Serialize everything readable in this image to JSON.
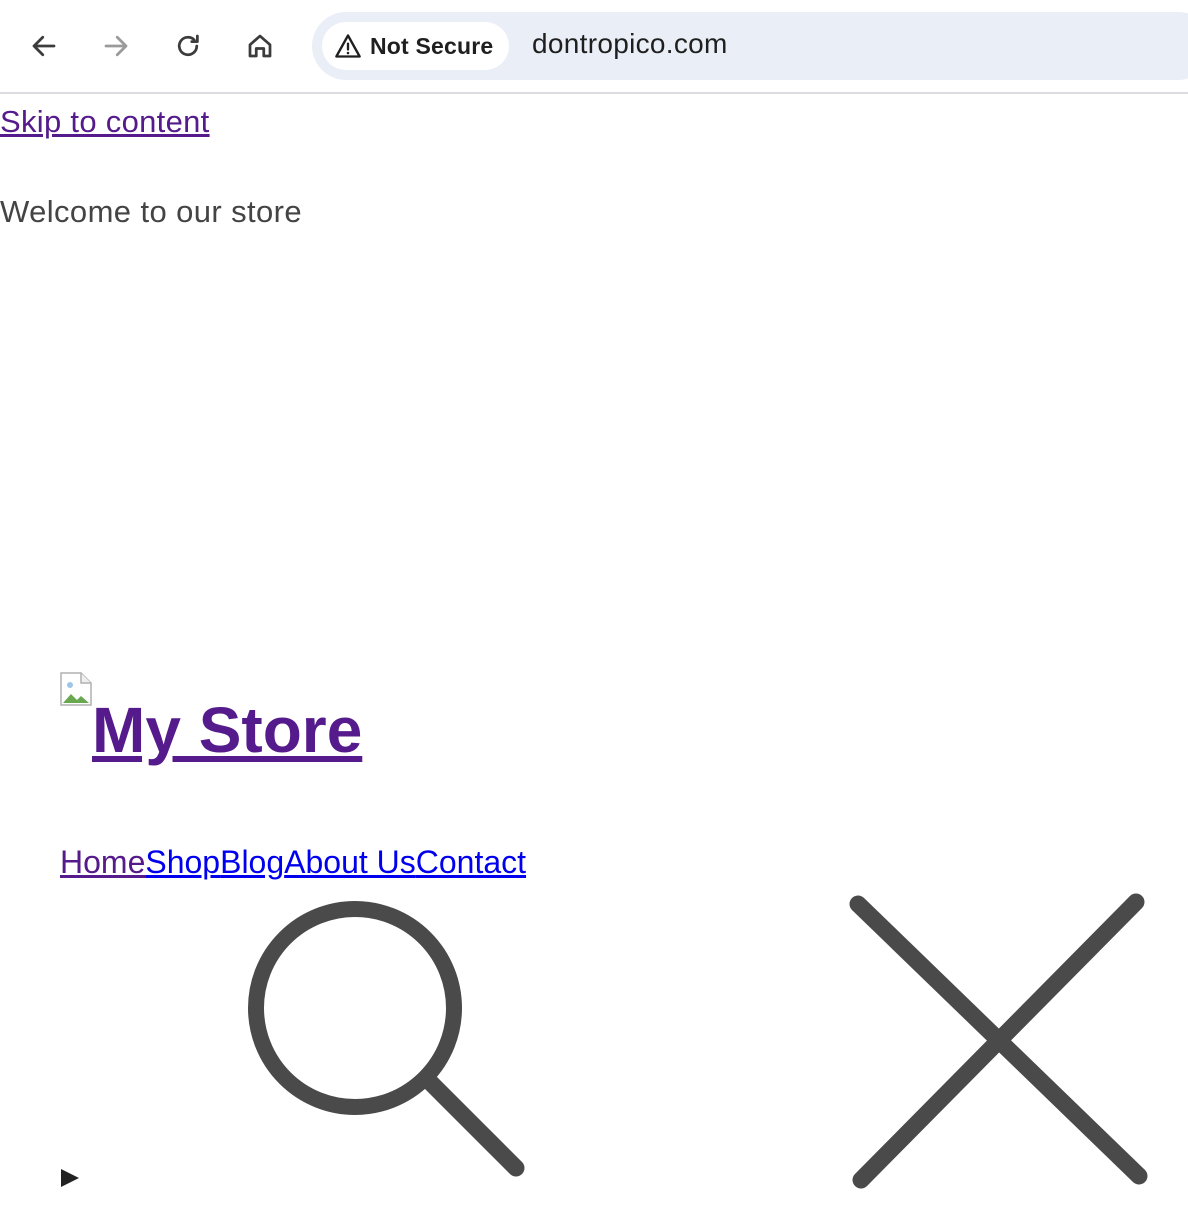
{
  "browser": {
    "security_label": "Not Secure",
    "url": "dontropico.com",
    "icons": {
      "back": "arrow-left-icon",
      "forward": "arrow-right-icon",
      "reload": "reload-icon",
      "home": "home-icon",
      "warning": "warning-triangle-icon"
    }
  },
  "page": {
    "skip_link": "Skip to content",
    "announcement": "Welcome to our store",
    "site_title": "My Store",
    "nav": [
      {
        "label": "Home"
      },
      {
        "label": "Shop"
      },
      {
        "label": "Blog"
      },
      {
        "label": "About Us"
      },
      {
        "label": "Contact"
      }
    ],
    "icons": {
      "search": "search-icon",
      "close": "close-icon",
      "disclosure": "triangle-right-icon",
      "logo": "broken-image-icon"
    },
    "colors": {
      "link": "#0000ee",
      "visited_link": "#551a8b",
      "icon_stroke": "#4a4a4a",
      "text_muted": "#444444"
    }
  }
}
